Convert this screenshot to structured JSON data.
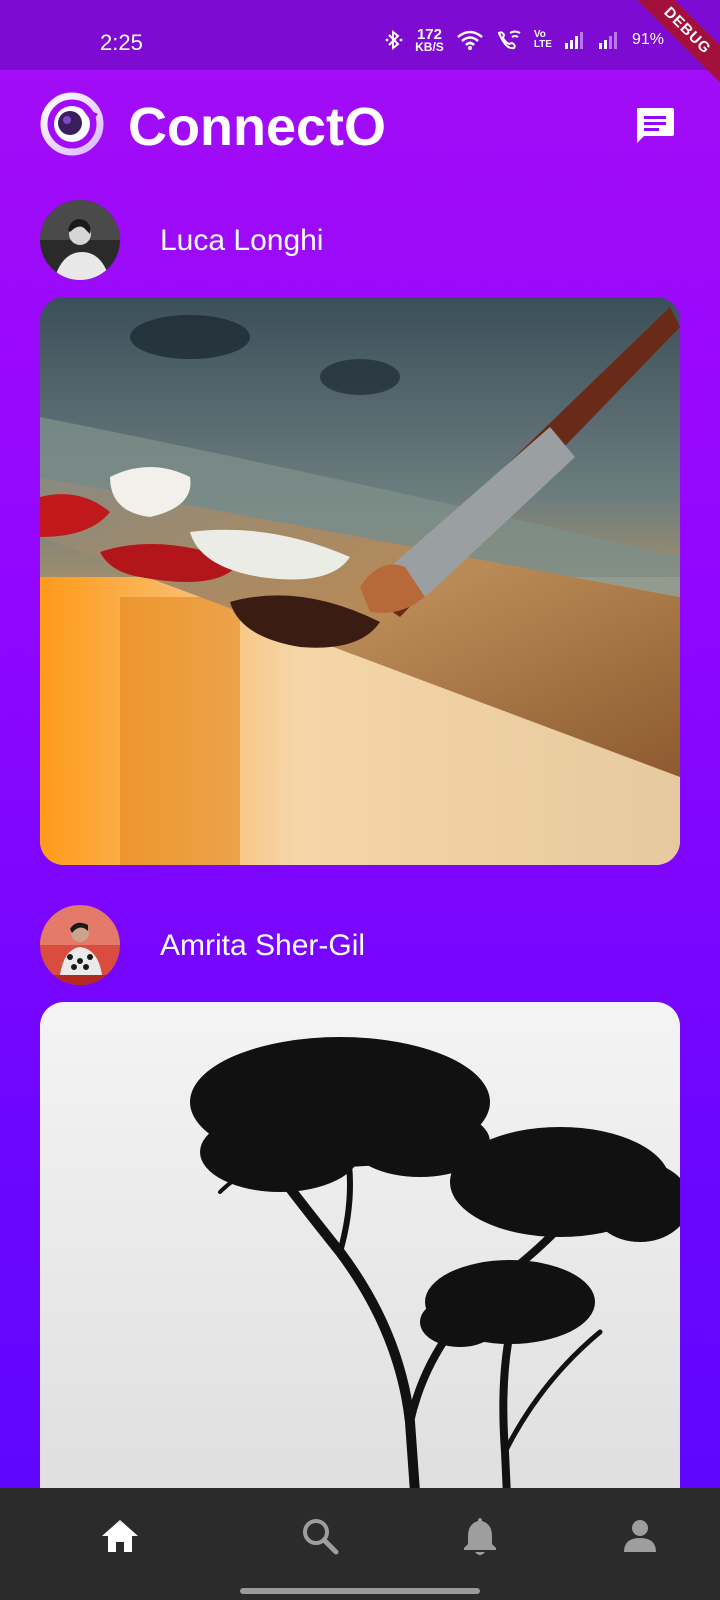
{
  "status_bar": {
    "time": "2:25",
    "net_speed_value": "172",
    "net_speed_unit": "KB/S",
    "volte_top": "Vo",
    "volte_bottom": "LTE",
    "battery": "91%",
    "debug_label": "DEBUG",
    "icons": [
      "bluetooth-icon",
      "wifi-icon",
      "wifi-calling-icon",
      "volte-icon",
      "signal-icon",
      "signal-icon",
      "battery-charging-icon"
    ]
  },
  "app_bar": {
    "title": "ConnectO",
    "logo_icon": "app-logo-icon",
    "chat_icon": "chat-icon"
  },
  "posts": [
    {
      "author": "Luca Longhi",
      "image_subject": "paint-palette-brush",
      "avatar_subject": "black-white-portrait"
    },
    {
      "author": "Amrita Sher-Gil",
      "image_subject": "tree-silhouette",
      "avatar_subject": "seated-figure-portrait"
    }
  ],
  "bottom_nav": {
    "items": [
      {
        "icon": "home-icon",
        "active": true
      },
      {
        "icon": "search-icon",
        "active": false
      },
      {
        "icon": "bell-icon",
        "active": false
      },
      {
        "icon": "person-icon",
        "active": false
      }
    ]
  },
  "colors": {
    "gradient_top": "#a40df6",
    "gradient_bottom": "#5b06ff",
    "status_bar": "#7e0bd2",
    "nav_bg": "#2b2b2b",
    "nav_active": "#ffffff",
    "nav_inactive": "#9e9e9e",
    "debug_ribbon": "#a4103c"
  }
}
